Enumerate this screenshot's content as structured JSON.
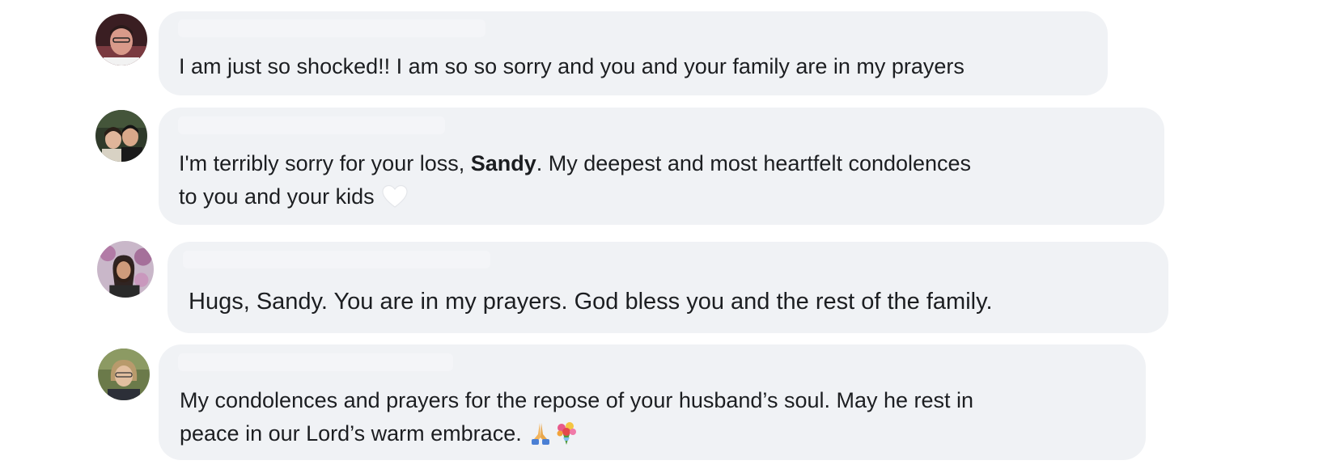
{
  "comments": [
    {
      "id": "c1",
      "parts": [
        "I am just so shocked!! I am so so sorry and you and your family are in my prayers"
      ]
    },
    {
      "id": "c2",
      "line1_pre": "I'm terribly sorry for your loss, ",
      "mention": "Sandy",
      "line1_post": ". My deepest and most heartfelt condolences",
      "line2": "to you and your kids",
      "emoji": "white-heart-icon"
    },
    {
      "id": "c3",
      "parts": [
        "Hugs, Sandy. You are in my prayers. God bless you and the rest of the family."
      ]
    },
    {
      "id": "c4",
      "line1": "My condolences and prayers for the repose of your husband’s soul. May he rest in",
      "line2": "peace in our Lord’s warm embrace.",
      "emojis": [
        "praying-hands-icon",
        "bouquet-icon"
      ]
    }
  ],
  "colors": {
    "bubble": "#f0f2f5",
    "text": "#1c1e21",
    "background": "#ffffff"
  }
}
